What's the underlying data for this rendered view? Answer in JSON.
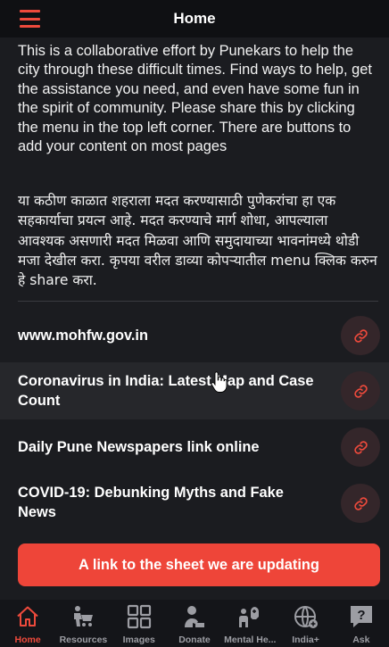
{
  "header": {
    "title": "Home",
    "menu_icon": "hamburger-menu-icon"
  },
  "intro": {
    "english": "This is a collaborative effort by Punekars to help the city through these difficult times. Find ways to help, get the assistance you need, and even have some fun in the spirit of community. Please share this by clicking the menu in the top left corner. There are buttons to add your content on most pages",
    "marathi": "या कठीण काळात शहराला मदत करण्यासाठी पुणेकरांचा हा एक सहकार्याचा प्रयत्न आहे. मदत करण्याचे मार्ग शोधा, आपल्याला आवश्यक असणारी मदत मिळवा आणि समुदायाच्या भावनांमध्ये थोडी मजा देखील करा. कृपया वरील डाव्या कोपऱ्यातील menu क्लिक करुन हे share करा."
  },
  "links": [
    {
      "title": "www.mohfw.gov.in",
      "icon": "link-icon"
    },
    {
      "title": "Coronavirus in India: Latest Map and Case Count",
      "icon": "link-icon"
    },
    {
      "title": "Daily Pune Newspapers link online",
      "icon": "link-icon"
    },
    {
      "title": "COVID-19: Debunking Myths and Fake News",
      "icon": "link-icon"
    }
  ],
  "cta": {
    "label": "A link to the sheet we are updating"
  },
  "tabs": [
    {
      "label": "Home",
      "icon": "home-icon",
      "active": true
    },
    {
      "label": "Resources",
      "icon": "cart-person-icon",
      "active": false
    },
    {
      "label": "Images",
      "icon": "image-grid-icon",
      "active": false
    },
    {
      "label": "Donate",
      "icon": "donate-person-icon",
      "active": false
    },
    {
      "label": "Mental He...",
      "icon": "mental-health-icon",
      "active": false
    },
    {
      "label": "India+",
      "icon": "globe-plus-icon",
      "active": false
    },
    {
      "label": "Ask",
      "icon": "question-icon",
      "active": false
    }
  ],
  "colors": {
    "accent": "#ee4a3c",
    "background": "#1b1c20",
    "header": "#0f1013",
    "tab_inactive": "#9c9da3"
  }
}
